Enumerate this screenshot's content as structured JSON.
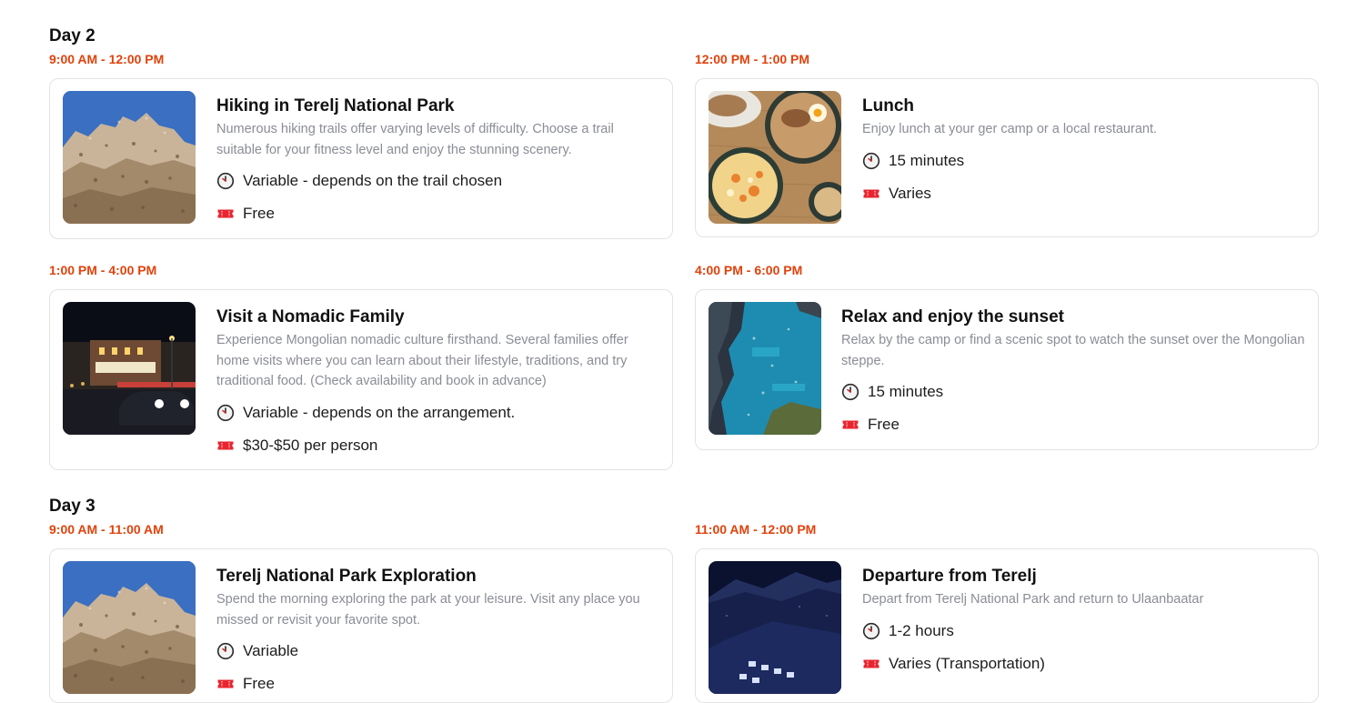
{
  "days": [
    {
      "label": "Day 2",
      "activities": [
        {
          "time": "9:00 AM - 12:00 PM",
          "title": "Hiking in Terelj National Park",
          "description": "Numerous hiking trails offer varying levels of difficulty. Choose a trail suitable for your fitness level and enjoy the stunning scenery.",
          "duration": "Variable - depends on the trail chosen",
          "cost": "Free",
          "image": "mountain-photo"
        },
        {
          "time": "12:00 PM - 1:00 PM",
          "title": "Lunch",
          "description": "Enjoy lunch at your ger camp or a local restaurant.",
          "duration": "15 minutes",
          "cost": "Varies",
          "image": "food-photo"
        },
        {
          "time": "1:00 PM - 4:00 PM",
          "title": "Visit a Nomadic Family",
          "description": "Experience Mongolian nomadic culture firsthand. Several families offer home visits where you can learn about their lifestyle, traditions, and try traditional food. (Check availability and book in advance)",
          "duration": "Variable - depends on the arrangement.",
          "cost": "$30-$50 per person",
          "image": "night-street-photo"
        },
        {
          "time": "4:00 PM - 6:00 PM",
          "title": "Relax and enjoy the sunset",
          "description": "Relax by the camp or find a scenic spot to watch the sunset over the Mongolian steppe.",
          "duration": "15 minutes",
          "cost": "Free",
          "image": "coast-photo"
        }
      ]
    },
    {
      "label": "Day 3",
      "activities": [
        {
          "time": "9:00 AM - 11:00 AM",
          "title": "Terelj National Park Exploration",
          "description": "Spend the morning exploring the park at your leisure. Visit any place you missed or revisit your favorite spot.",
          "duration": "Variable",
          "cost": "Free",
          "image": "mountain-photo"
        },
        {
          "time": "11:00 AM - 12:00 PM",
          "title": "Departure from Terelj",
          "description": "Depart from Terelj National Park and return to Ulaanbaatar",
          "duration": "1-2 hours",
          "cost": "Varies (Transportation)",
          "image": "snow-night-photo"
        }
      ]
    }
  ],
  "icons": {
    "duration": "clock-icon",
    "cost": "ticket-icon"
  },
  "colors": {
    "time": "#e0420c",
    "ticket": "#e8242f",
    "description": "#8a8d95"
  }
}
